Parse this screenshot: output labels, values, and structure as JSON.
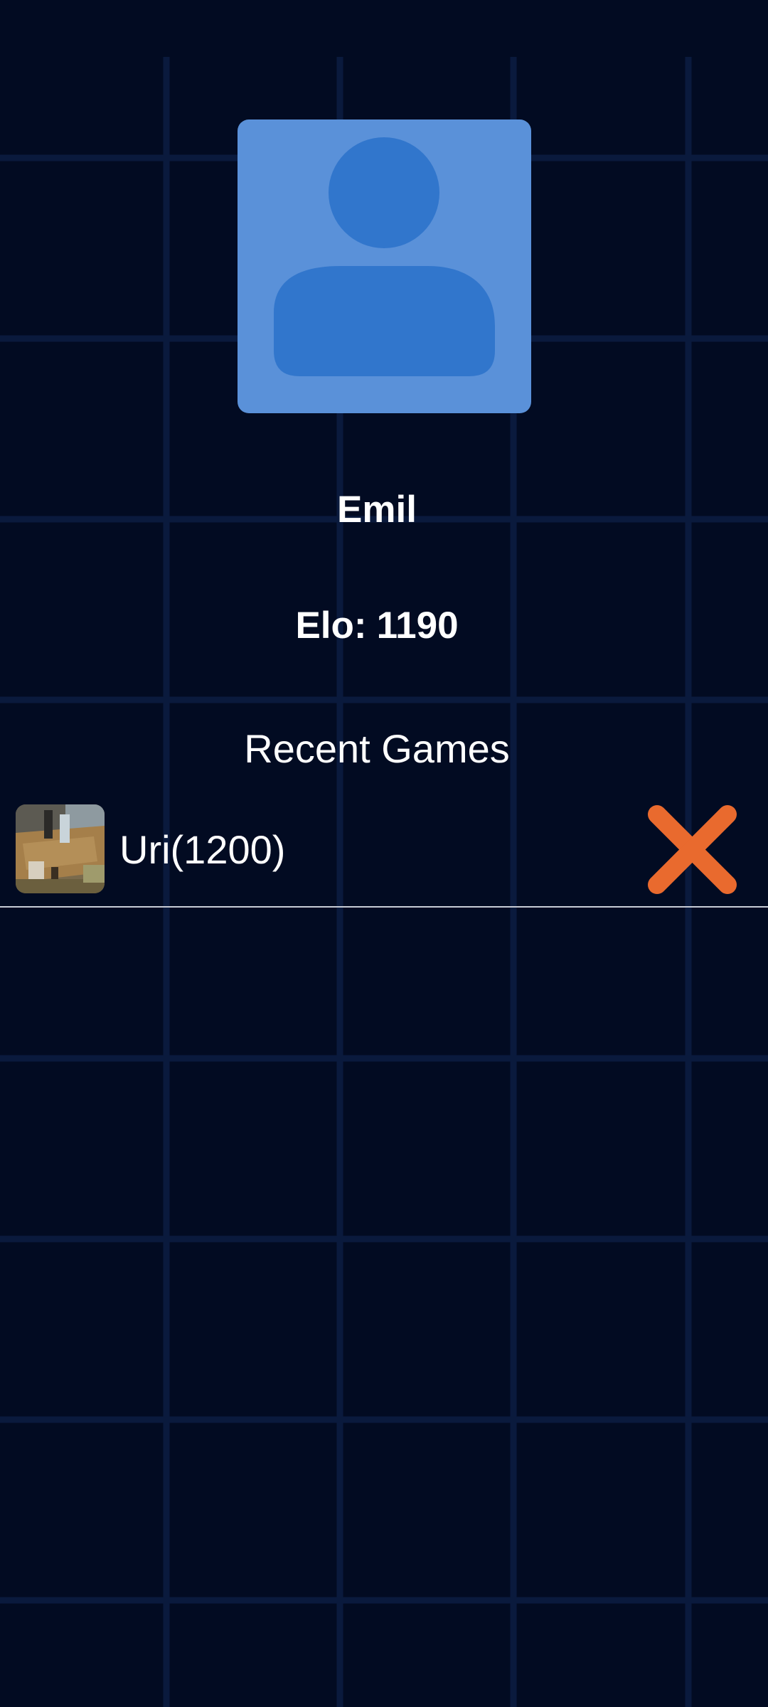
{
  "profile": {
    "name": "Emil",
    "elo_label": "Elo:",
    "elo_value": "1190",
    "avatar_icon": "person-placeholder-icon"
  },
  "recent_games": {
    "title": "Recent Games",
    "items": [
      {
        "opponent": "Uri(1200)",
        "thumbnail": "opponent-photo",
        "result_icon": "loss-x-icon"
      }
    ]
  },
  "colors": {
    "background": "#020b22",
    "grid_line": "#0a1a3d",
    "avatar_bg": "#5a91d9",
    "avatar_figure": "#3176cc",
    "loss": "#e96a2e",
    "divider": "#c8ccd6",
    "text": "#ffffff"
  }
}
